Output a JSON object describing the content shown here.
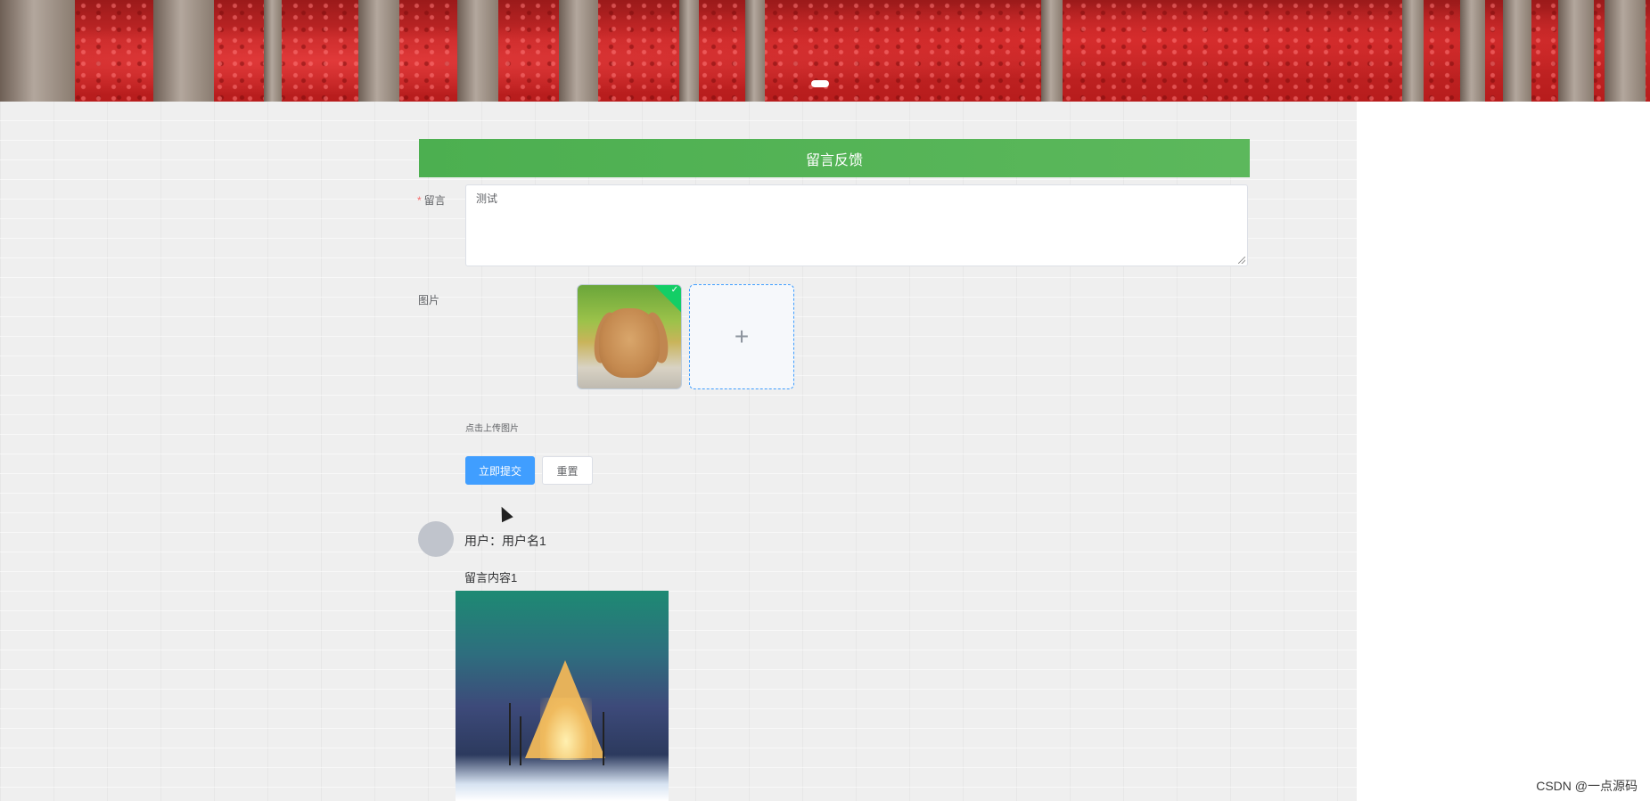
{
  "banner": {
    "carousel_indicator": "active-dot"
  },
  "form": {
    "title": "留言反馈",
    "message_label": "留言",
    "message_required_mark": "*",
    "message_value": "测试",
    "image_label": "图片",
    "uploaded_image": "bunny-thumbnail",
    "upload_plus_icon": "+",
    "upload_tip": "点击上传图片",
    "submit_label": "立即提交",
    "reset_label": "重置"
  },
  "comments": [
    {
      "user": "用户：用户名1",
      "content": "留言内容1",
      "image": "aurora-cabin-photo"
    }
  ],
  "watermark": "CSDN @一点源码",
  "colors": {
    "header_green": "#5cb85c",
    "primary_blue": "#409eff",
    "success_green": "#13ce66",
    "required_red": "#f56c6c"
  }
}
